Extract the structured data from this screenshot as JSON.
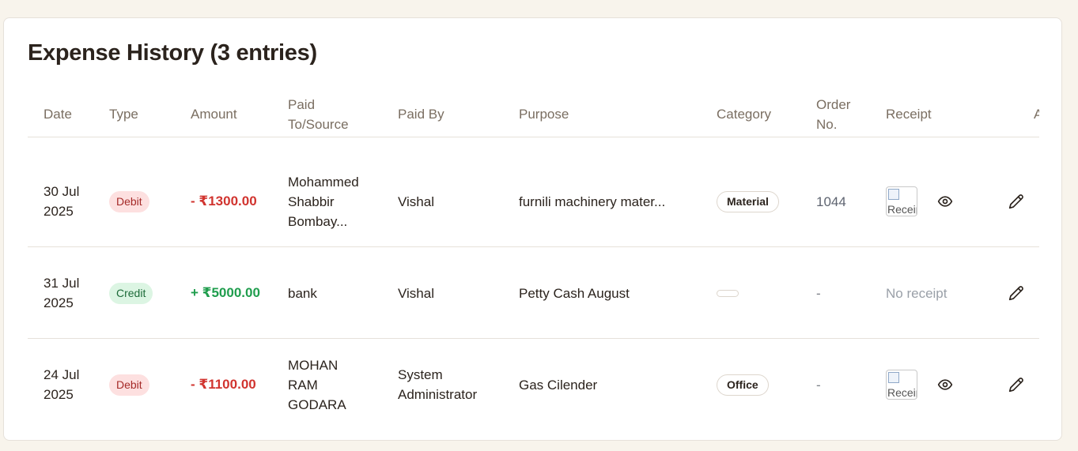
{
  "title": "Expense History (3 entries)",
  "columns": {
    "date": "Date",
    "type": "Type",
    "amount": "Amount",
    "paid_to": "Paid To/Source",
    "paid_by": "Paid By",
    "purpose": "Purpose",
    "category": "Category",
    "order_no": "Order No.",
    "receipt": "Receipt",
    "actions": "A"
  },
  "rows": [
    {
      "date": "30 Jul 2025",
      "type": "Debit",
      "amount": "- ₹1300.00",
      "paid_to": "Mohammed Shabbir Bombay...",
      "paid_by": "Vishal",
      "purpose": "furnili machinery mater...",
      "category": "Material",
      "order_no": "1044",
      "receipt_alt": "Receipt",
      "has_receipt": true
    },
    {
      "date": "31 Jul 2025",
      "type": "Credit",
      "amount": "+ ₹5000.00",
      "paid_to": "bank",
      "paid_by": "Vishal",
      "purpose": "Petty Cash August",
      "category": "",
      "order_no": "-",
      "receipt_text": "No receipt",
      "has_receipt": false
    },
    {
      "date": "24 Jul 2025",
      "type": "Debit",
      "amount": "- ₹1100.00",
      "paid_to": "MOHAN RAM GODARA",
      "paid_by": "System Administrator",
      "purpose": "Gas Cilender",
      "category": "Office",
      "order_no": "-",
      "receipt_alt": "Receipt",
      "has_receipt": true
    }
  ],
  "icons": {
    "view": "eye-icon",
    "edit": "pencil-icon",
    "broken_image": "broken-image-icon"
  },
  "colors": {
    "debit": "#d1342f",
    "credit": "#1f9d4d",
    "background": "#f8f4ec"
  }
}
